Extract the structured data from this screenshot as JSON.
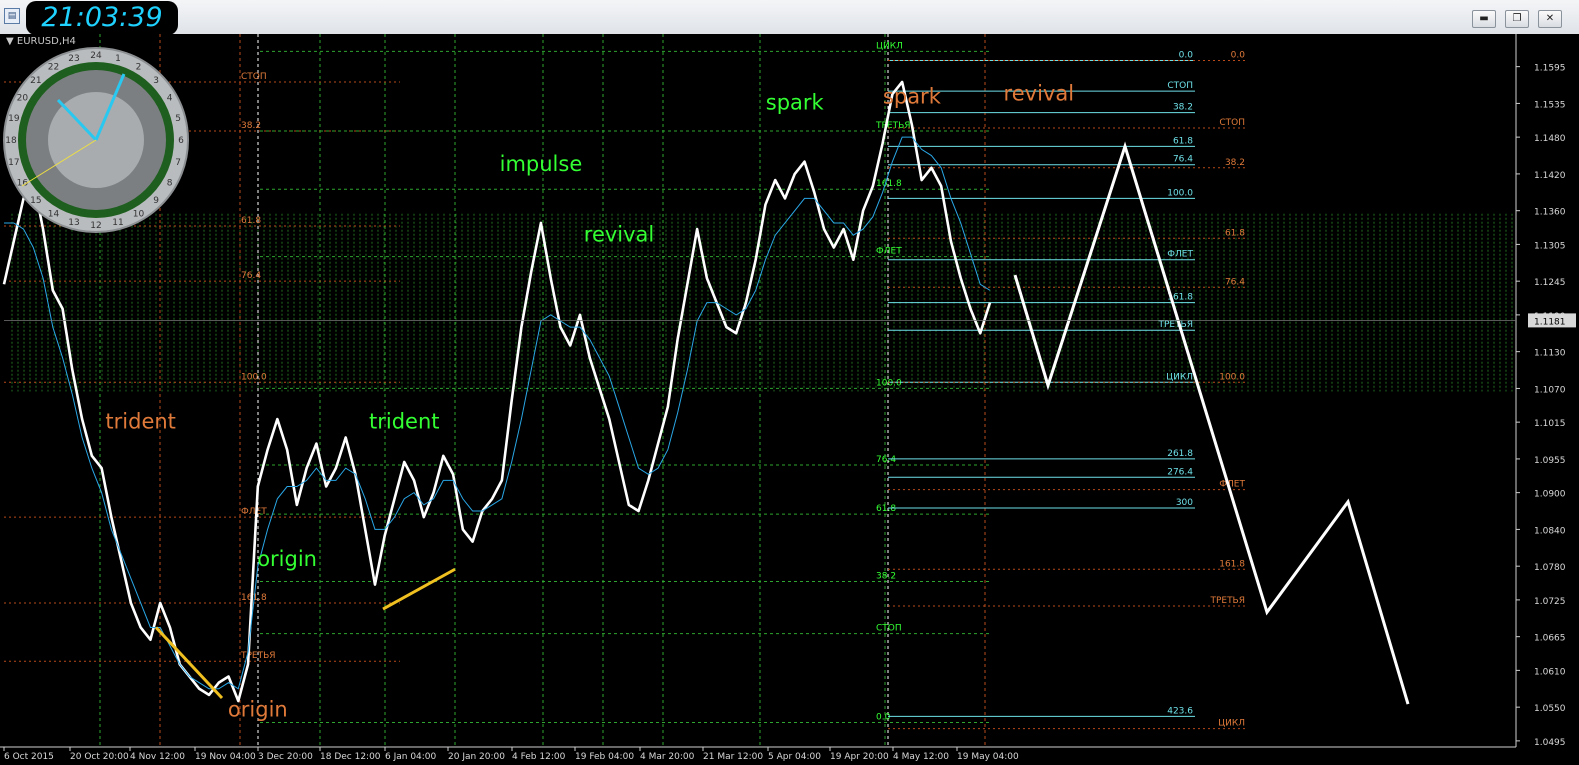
{
  "window": {
    "clock_time": "21:03:39",
    "symbol_label": "▼ EURUSD,H4",
    "buttons": [
      "minimize",
      "restore",
      "close"
    ]
  },
  "colors": {
    "background": "#000000",
    "price": "#ffffff",
    "ma": "#2aa7e6",
    "grid_green": "#2ea52e",
    "grid_orange": "#b84a1a",
    "level_cyan": "#6ee0e8",
    "label_green": "#33ff33",
    "label_orange": "#e07a3a",
    "trend_yellow": "#f0c020",
    "projection": "#ffffff"
  },
  "chart_data": {
    "type": "line",
    "title": "",
    "ylim": [
      1.0485,
      1.1645
    ],
    "y_ticks": [
      "1.1595",
      "1.1535",
      "1.1480",
      "1.1420",
      "1.1360",
      "1.1305",
      "1.1245",
      "1.1190",
      "1.1130",
      "1.1070",
      "1.1015",
      "1.0955",
      "1.0900",
      "1.0840",
      "1.0780",
      "1.0725",
      "1.0665",
      "1.0610",
      "1.0550",
      "1.0495"
    ],
    "current_price": "1.1181",
    "x_ticks": [
      "6 Oct 2015",
      "20 Oct 20:00",
      "4 Nov 12:00",
      "19 Nov 04:00",
      "3 Dec 20:00",
      "18 Dec 12:00",
      "6 Jan 04:00",
      "20 Jan 20:00",
      "4 Feb 12:00",
      "19 Feb 04:00",
      "4 Mar 20:00",
      "21 Mar 12:00",
      "5 Apr 04:00",
      "19 Apr 20:00",
      "4 May 12:00",
      "19 May 04:00"
    ],
    "series": [
      {
        "values": [
          1.124,
          1.131,
          1.138,
          1.141,
          1.133,
          1.123,
          1.12,
          1.11,
          1.102,
          1.096,
          1.094,
          1.086,
          1.079,
          1.072,
          1.068,
          1.066,
          1.072,
          1.068,
          1.062,
          1.06,
          1.058,
          1.057,
          1.059,
          1.06,
          1.056,
          1.062,
          1.091,
          1.097,
          1.102,
          1.097,
          1.088,
          1.094,
          1.098,
          1.091,
          1.094,
          1.099,
          1.093,
          1.084,
          1.075,
          1.083,
          1.089,
          1.095,
          1.092,
          1.086,
          1.09,
          1.096,
          1.093,
          1.084,
          1.082,
          1.087,
          1.089,
          1.092,
          1.105,
          1.117,
          1.126,
          1.134,
          1.125,
          1.117,
          1.114,
          1.119,
          1.112,
          1.107,
          1.102,
          1.095,
          1.088,
          1.087,
          1.092,
          1.098,
          1.104,
          1.115,
          1.124,
          1.133,
          1.125,
          1.121,
          1.117,
          1.116,
          1.121,
          1.128,
          1.137,
          1.141,
          1.138,
          1.142,
          1.144,
          1.139,
          1.133,
          1.13,
          1.133,
          1.128,
          1.136,
          1.14,
          1.147,
          1.155,
          1.157,
          1.15,
          1.141,
          1.143,
          1.14,
          1.131,
          1.125,
          1.12,
          1.116,
          1.121
        ]
      },
      {
        "values": [
          1.134,
          1.134,
          1.133,
          1.13,
          1.125,
          1.117,
          1.112,
          1.106,
          1.099,
          1.094,
          1.09,
          1.084,
          1.08,
          1.076,
          1.072,
          1.068,
          1.068,
          1.065,
          1.062,
          1.06,
          1.059,
          1.058,
          1.058,
          1.059,
          1.058,
          1.064,
          1.078,
          1.084,
          1.089,
          1.091,
          1.091,
          1.092,
          1.094,
          1.092,
          1.092,
          1.094,
          1.093,
          1.089,
          1.084,
          1.084,
          1.086,
          1.089,
          1.09,
          1.088,
          1.089,
          1.092,
          1.092,
          1.089,
          1.087,
          1.087,
          1.088,
          1.089,
          1.095,
          1.102,
          1.11,
          1.118,
          1.119,
          1.118,
          1.117,
          1.117,
          1.115,
          1.112,
          1.109,
          1.104,
          1.099,
          1.094,
          1.093,
          1.094,
          1.097,
          1.103,
          1.11,
          1.118,
          1.121,
          1.121,
          1.12,
          1.119,
          1.12,
          1.123,
          1.128,
          1.132,
          1.134,
          1.136,
          1.138,
          1.138,
          1.136,
          1.134,
          1.134,
          1.132,
          1.133,
          1.135,
          1.139,
          1.144,
          1.148,
          1.148,
          1.146,
          1.145,
          1.143,
          1.138,
          1.134,
          1.129,
          1.124,
          1.123
        ]
      }
    ],
    "projection": [
      [
        1.1255,
        1.1075,
        1.1465,
        1.0705,
        1.0885,
        1.0555
      ]
    ],
    "levels_cyan": [
      {
        "label": "0.0",
        "y": 1.1605
      },
      {
        "label": "СТОП",
        "y": 1.1555
      },
      {
        "label": "38.2",
        "y": 1.152
      },
      {
        "label": "61.8",
        "y": 1.1465
      },
      {
        "label": "76.4",
        "y": 1.1435
      },
      {
        "label": "100.0",
        "y": 1.138
      },
      {
        "label": "ФЛЕТ",
        "y": 1.128
      },
      {
        "label": "161.8",
        "y": 1.121
      },
      {
        "label": "ТРЕТЬЯ",
        "y": 1.1165
      },
      {
        "label": "ЦИКЛ",
        "y": 1.108
      },
      {
        "label": "261.8",
        "y": 1.0955
      },
      {
        "label": "276.4",
        "y": 1.0925
      },
      {
        "label": "300",
        "y": 1.0875
      },
      {
        "label": "423.6",
        "y": 1.0535
      }
    ],
    "levels_orange": [
      {
        "label": "0.0",
        "y": 1.1605
      },
      {
        "label": "СТОП",
        "y": 1.1495
      },
      {
        "label": "38.2",
        "y": 1.143
      },
      {
        "label": "61.8",
        "y": 1.1315
      },
      {
        "label": "76.4",
        "y": 1.1235
      },
      {
        "label": "100.0",
        "y": 1.108
      },
      {
        "label": "ФЛЕТ",
        "y": 1.0905
      },
      {
        "label": "161.8",
        "y": 1.0775
      },
      {
        "label": "ТРЕТЬЯ",
        "y": 1.0715
      },
      {
        "label": "ЦИКЛ",
        "y": 1.0515
      }
    ],
    "levels_left_orange": [
      {
        "label": "СТОП",
        "y": 1.157
      },
      {
        "label": "38.2",
        "y": 1.149
      },
      {
        "label": "61.8",
        "y": 1.1335
      },
      {
        "label": "76.4",
        "y": 1.1245
      },
      {
        "label": "100.0",
        "y": 1.108
      },
      {
        "label": "ФЛЕТ",
        "y": 1.086
      },
      {
        "label": "161.8",
        "y": 1.072
      },
      {
        "label": "ТРЕТЬЯ",
        "y": 1.0625
      }
    ],
    "levels_mid_green": [
      {
        "label": "ЦИКЛ",
        "y": 1.162
      },
      {
        "label": "ТРЕТЬЯ",
        "y": 1.149
      },
      {
        "label": "161.8",
        "y": 1.1395
      },
      {
        "label": "ФЛЕТ",
        "y": 1.1285
      },
      {
        "label": "100.0",
        "y": 1.107
      },
      {
        "label": "76.4",
        "y": 1.0945
      },
      {
        "label": "61.8",
        "y": 1.0865
      },
      {
        "label": "38.2",
        "y": 1.0755
      },
      {
        "label": "СТОП",
        "y": 1.067
      },
      {
        "label": "0.0",
        "y": 1.0525
      }
    ],
    "annotations": [
      {
        "text": "trident",
        "color": "orange",
        "x_idx": 14,
        "y": 1.1005
      },
      {
        "text": "trident",
        "color": "green",
        "x_idx": 41,
        "y": 1.1005
      },
      {
        "text": "impulse",
        "color": "green",
        "x_idx": 55,
        "y": 1.1425
      },
      {
        "text": "revival",
        "color": "green",
        "x_idx": 63,
        "y": 1.131
      },
      {
        "text": "spark",
        "color": "green",
        "x_idx": 81,
        "y": 1.1525
      },
      {
        "text": "spark",
        "color": "orange",
        "x_idx": 93,
        "y": 1.1535
      },
      {
        "text": "revival",
        "color": "orange",
        "x_idx": 106,
        "y": 1.154
      },
      {
        "text": "origin",
        "color": "green",
        "x_idx": 29,
        "y": 1.078
      },
      {
        "text": "origin",
        "color": "orange",
        "x_idx": 26,
        "y": 1.0535
      }
    ]
  }
}
